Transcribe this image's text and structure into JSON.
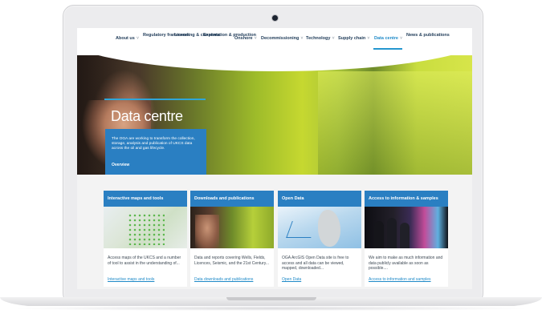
{
  "nav": {
    "items": [
      {
        "label": "About us",
        "chevron": "˅"
      },
      {
        "label": "Regulatory framework",
        "chevron": "˅"
      },
      {
        "label": "Licensing & consents",
        "chevron": "˅"
      },
      {
        "label": "Exploration & production",
        "chevron": "˅"
      },
      {
        "label": "Onshore",
        "chevron": "˅"
      },
      {
        "label": "Decommissioning",
        "chevron": "˅"
      },
      {
        "label": "Technology",
        "chevron": "˅"
      },
      {
        "label": "Supply chain",
        "chevron": "˅"
      },
      {
        "label": "Data centre",
        "chevron": "˅"
      },
      {
        "label": "News & publications",
        "chevron": "˅"
      }
    ],
    "active": "Data centre"
  },
  "hero": {
    "title": "Data centre",
    "text": "The OGA are working to transform the collection, storage, analysis and publication of UKCS data across the oil and gas lifecycle.",
    "link": "Overview"
  },
  "cards": [
    {
      "title": "Interactive maps and tools",
      "image": "map-image",
      "text": "Access maps of the UKCS and a number of tool to assist in the understanding of...",
      "link": "Interactive maps and tools"
    },
    {
      "title": "Downloads and publications",
      "image": "photo-image",
      "text": "Data and reports covering Wells, Fields, Licences, Seismic, and the 21st Century...",
      "link": "Data downloads and publications"
    },
    {
      "title": "Open Data",
      "image": "sea-map-image",
      "text": "OGA ArcGIS Open Data site is free to access and all data can be viewed, mapped, downloaded...",
      "link": "Open Data"
    },
    {
      "title": "Access to information & samples",
      "image": "vr-image",
      "text": "We aim to make as much information and data publicly available as soon as possible....",
      "link": "Access to information and samples"
    }
  ],
  "colors": {
    "brand_blue": "#2a7fc2",
    "nav_text": "#1f3b58",
    "link": "#1f8ac8"
  }
}
